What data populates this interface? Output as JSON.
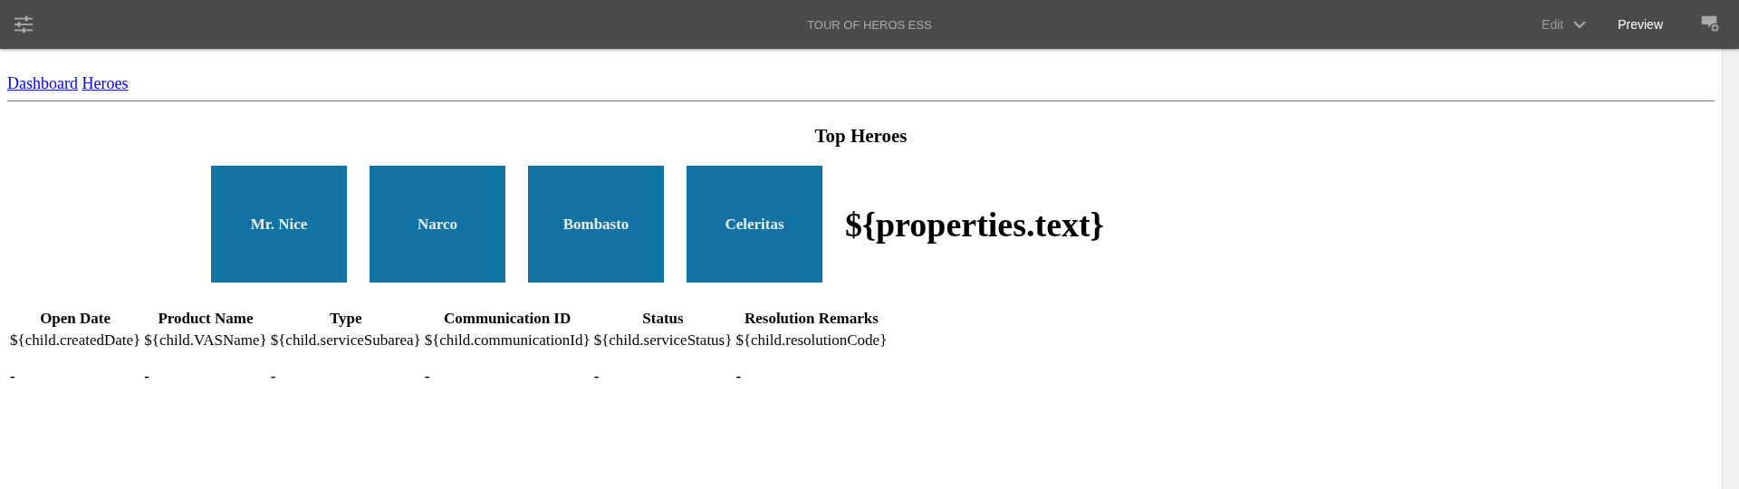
{
  "toolbar": {
    "title": "TOUR OF HEROS ESS",
    "mode": "Edit",
    "preview": "Preview"
  },
  "nav": {
    "links": [
      "Dashboard",
      "Heroes"
    ]
  },
  "top_heroes": {
    "heading": "Top Heroes",
    "heroes": [
      "Mr. Nice",
      "Narco",
      "Bombasto",
      "Celeritas"
    ],
    "text": "${properties.text}"
  },
  "table": {
    "columns": [
      "Open Date",
      "Product Name",
      "Type",
      "Communication ID",
      "Status",
      "Resolution Remarks"
    ],
    "rows": [
      {
        "kind": "template",
        "cells": [
          "${child.createdDate}",
          "${child.VASName}",
          "${child.serviceSubarea}",
          "${child.communicationId}",
          "${child.serviceStatus}",
          "${child.resolutionCode}"
        ]
      },
      {
        "kind": "dash",
        "cells": [
          "-",
          "-",
          "-",
          "-",
          "-",
          "-"
        ]
      }
    ]
  }
}
